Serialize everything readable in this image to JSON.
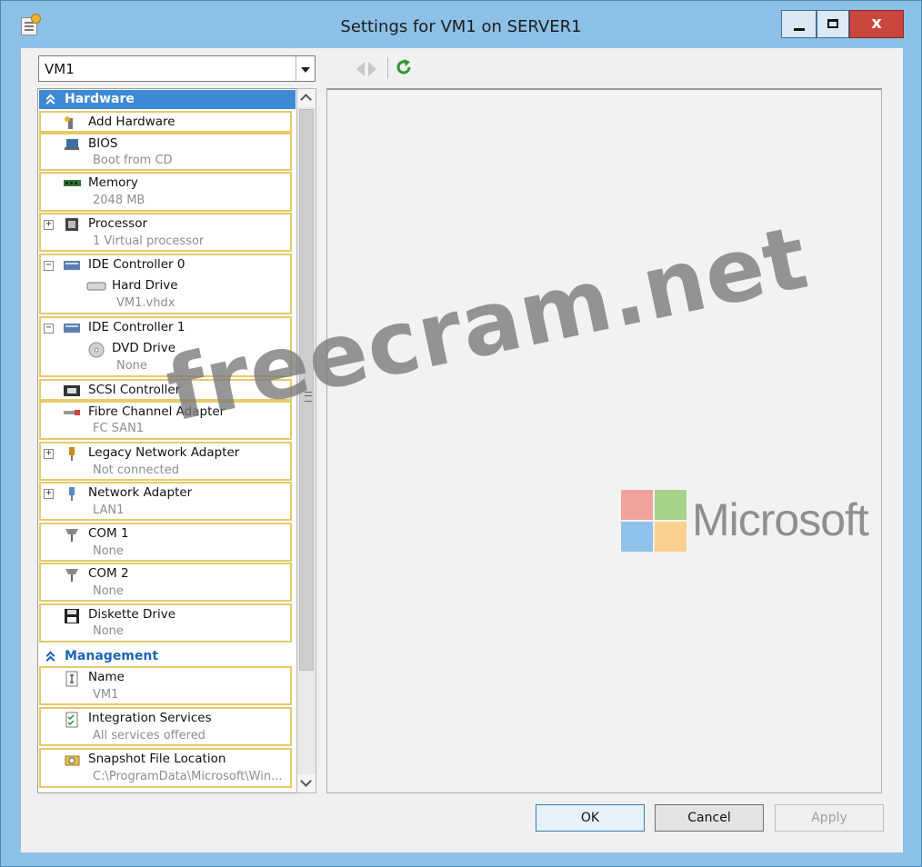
{
  "window": {
    "title": "Settings for VM1 on SERVER1",
    "close_label": "x"
  },
  "toolbar": {
    "vm_selected": "VM1"
  },
  "tree": {
    "hardware_label": "Hardware",
    "management_label": "Management",
    "items": [
      {
        "title": "Add Hardware",
        "subtitle": ""
      },
      {
        "title": "BIOS",
        "subtitle": "Boot from CD"
      },
      {
        "title": "Memory",
        "subtitle": "2048 MB"
      },
      {
        "title": "Processor",
        "subtitle": "1 Virtual processor"
      },
      {
        "title": "IDE Controller 0",
        "child_title": "Hard Drive",
        "child_subtitle": "VM1.vhdx"
      },
      {
        "title": "IDE Controller 1",
        "child_title": "DVD Drive",
        "child_subtitle": "None"
      },
      {
        "title": "SCSI Controller",
        "subtitle": ""
      },
      {
        "title": "Fibre Channel Adapter",
        "subtitle": "FC SAN1"
      },
      {
        "title": "Legacy Network Adapter",
        "subtitle": "Not connected"
      },
      {
        "title": "Network Adapter",
        "subtitle": "LAN1"
      },
      {
        "title": "COM 1",
        "subtitle": "None"
      },
      {
        "title": "COM 2",
        "subtitle": "None"
      },
      {
        "title": "Diskette Drive",
        "subtitle": "None"
      }
    ],
    "management_items": [
      {
        "title": "Name",
        "subtitle": "VM1"
      },
      {
        "title": "Integration Services",
        "subtitle": "All services offered"
      },
      {
        "title": "Snapshot File Location",
        "subtitle": "C:\\ProgramData\\Microsoft\\Win..."
      }
    ]
  },
  "buttons": {
    "ok": "OK",
    "cancel": "Cancel",
    "apply": "Apply"
  },
  "watermark": {
    "text": "freecram.net"
  },
  "logo": {
    "text": "Microsoft",
    "colors": [
      "#f1a29b",
      "#a7d38a",
      "#8fc2ea",
      "#f9d08e"
    ]
  },
  "colors": {
    "accent": "#3e89d4",
    "selection_border": "#e6c96a",
    "title_bar": "#8cc0e6"
  }
}
